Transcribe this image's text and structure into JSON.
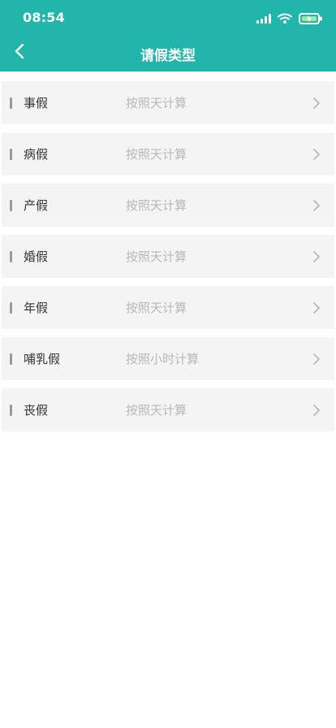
{
  "status_bar": {
    "time": "08:54",
    "icons": [
      "signal-icon",
      "wifi-icon",
      "battery-charging-icon"
    ]
  },
  "nav": {
    "title": "请假类型",
    "back_icon": "chevron-left-icon"
  },
  "leave_types": [
    {
      "name": "事假",
      "desc": "按照天计算"
    },
    {
      "name": "病假",
      "desc": "按照天计算"
    },
    {
      "name": "产假",
      "desc": "按照天计算"
    },
    {
      "name": "婚假",
      "desc": "按照天计算"
    },
    {
      "name": "年假",
      "desc": "按照天计算"
    },
    {
      "name": "哺乳假",
      "desc": "按照小时计算"
    },
    {
      "name": "丧假",
      "desc": "按照天计算"
    }
  ],
  "colors": {
    "header": "#22b5ab",
    "row_bg": "#f4f4f4",
    "text": "#333333",
    "desc_text": "#b8b8b8",
    "accent_bar": "#9a9a9a"
  }
}
